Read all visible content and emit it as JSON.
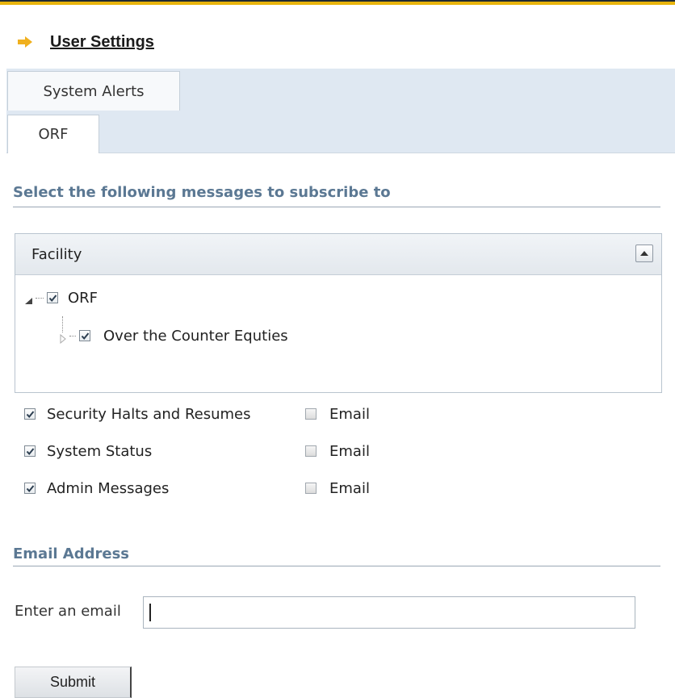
{
  "header": {
    "title": "User Settings"
  },
  "tabs": [
    {
      "label": "System Alerts"
    },
    {
      "label": "ORF"
    }
  ],
  "subscribe_section": {
    "title": "Select the following messages to subscribe to"
  },
  "facility_panel": {
    "header": "Facility",
    "tree": [
      {
        "label": "ORF",
        "checked": true,
        "expanded": true
      },
      {
        "label": "Over the Counter Equties",
        "checked": true,
        "expanded": false
      }
    ]
  },
  "messages": [
    {
      "label": "Security Halts and Resumes",
      "checked": true,
      "email_label": "Email",
      "email_checked": false
    },
    {
      "label": "System Status",
      "checked": true,
      "email_label": "Email",
      "email_checked": false
    },
    {
      "label": "Admin Messages",
      "checked": true,
      "email_label": "Email",
      "email_checked": false
    }
  ],
  "email_section": {
    "title": "Email Address",
    "field_label": "Enter an email",
    "value": "",
    "placeholder": ""
  },
  "submit_label": "Submit",
  "colors": {
    "accent_bar": "#e8b40c",
    "section_title": "#5b7893",
    "tab_bg": "#dfe8f2"
  }
}
